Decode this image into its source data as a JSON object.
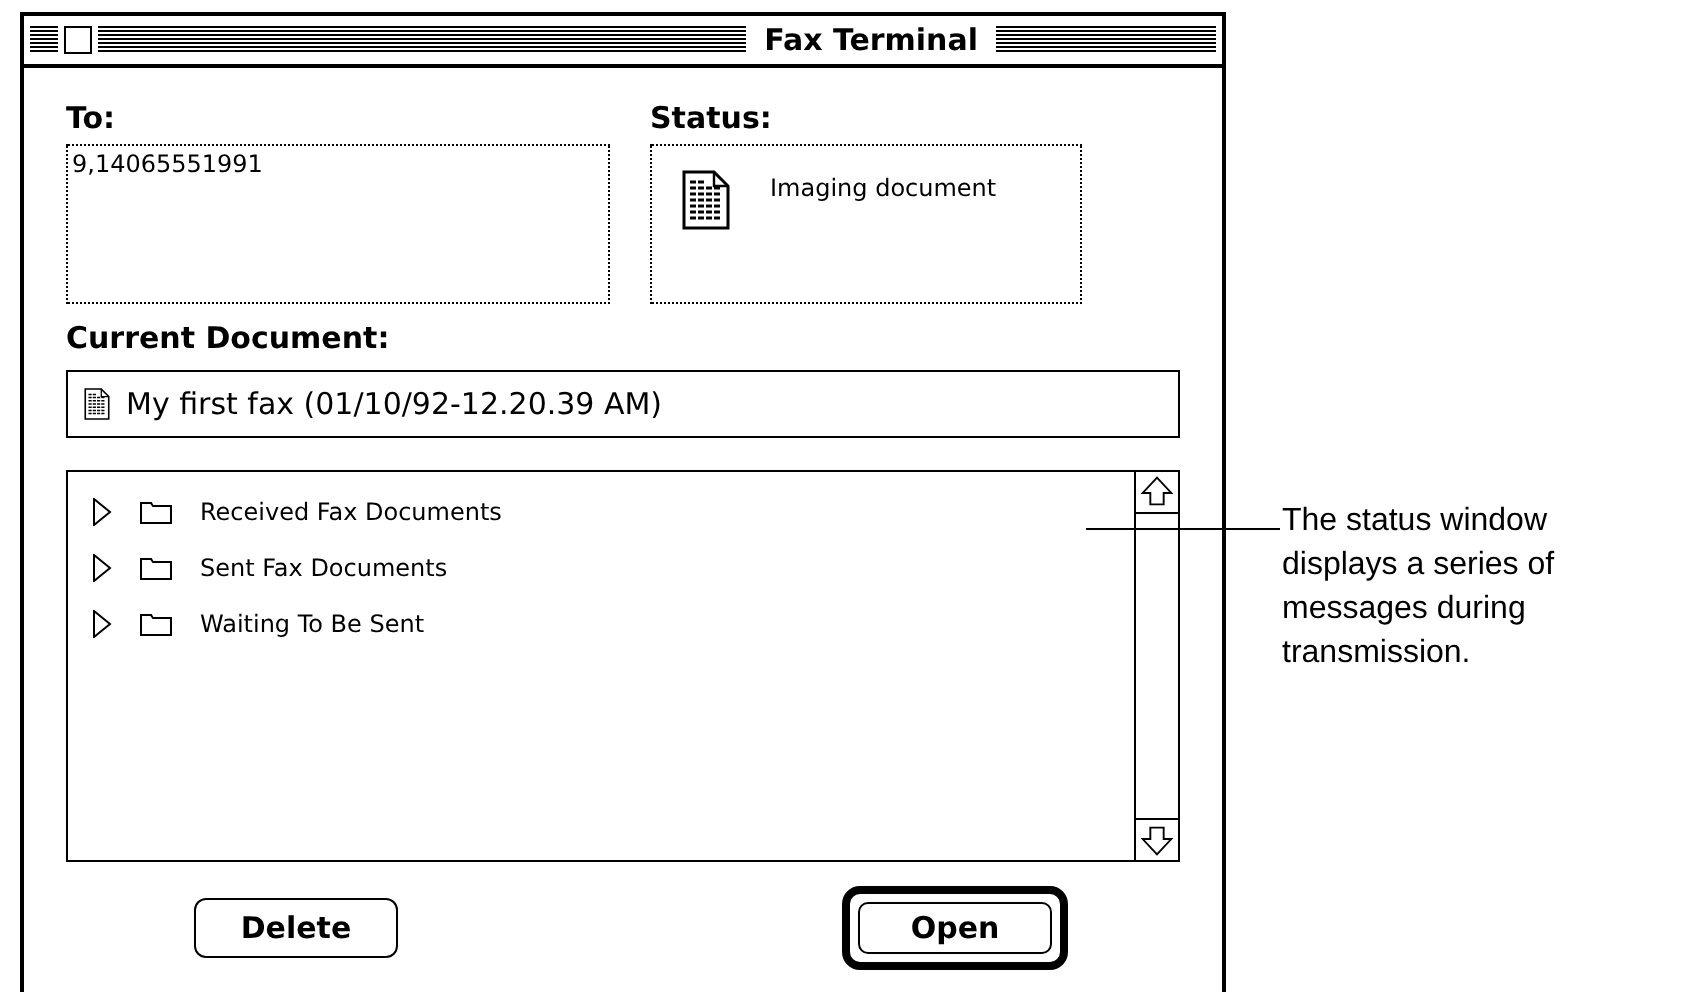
{
  "window": {
    "title": "Fax Terminal"
  },
  "to": {
    "label": "To:",
    "value": "9,14065551991"
  },
  "status": {
    "label": "Status:",
    "message": "Imaging document"
  },
  "current_document": {
    "label": "Current Document:",
    "value": "My first fax (01/10/92-12.20.39 AM)"
  },
  "folders": [
    {
      "name": "Received Fax Documents",
      "expanded": false
    },
    {
      "name": "Sent Fax Documents",
      "expanded": false
    },
    {
      "name": "Waiting To Be Sent",
      "expanded": false
    }
  ],
  "buttons": [
    {
      "label": "Delete",
      "default": false
    },
    {
      "label": "Open",
      "default": true
    }
  ],
  "callout": {
    "text": "The status window displays a series of messages during transmission."
  }
}
